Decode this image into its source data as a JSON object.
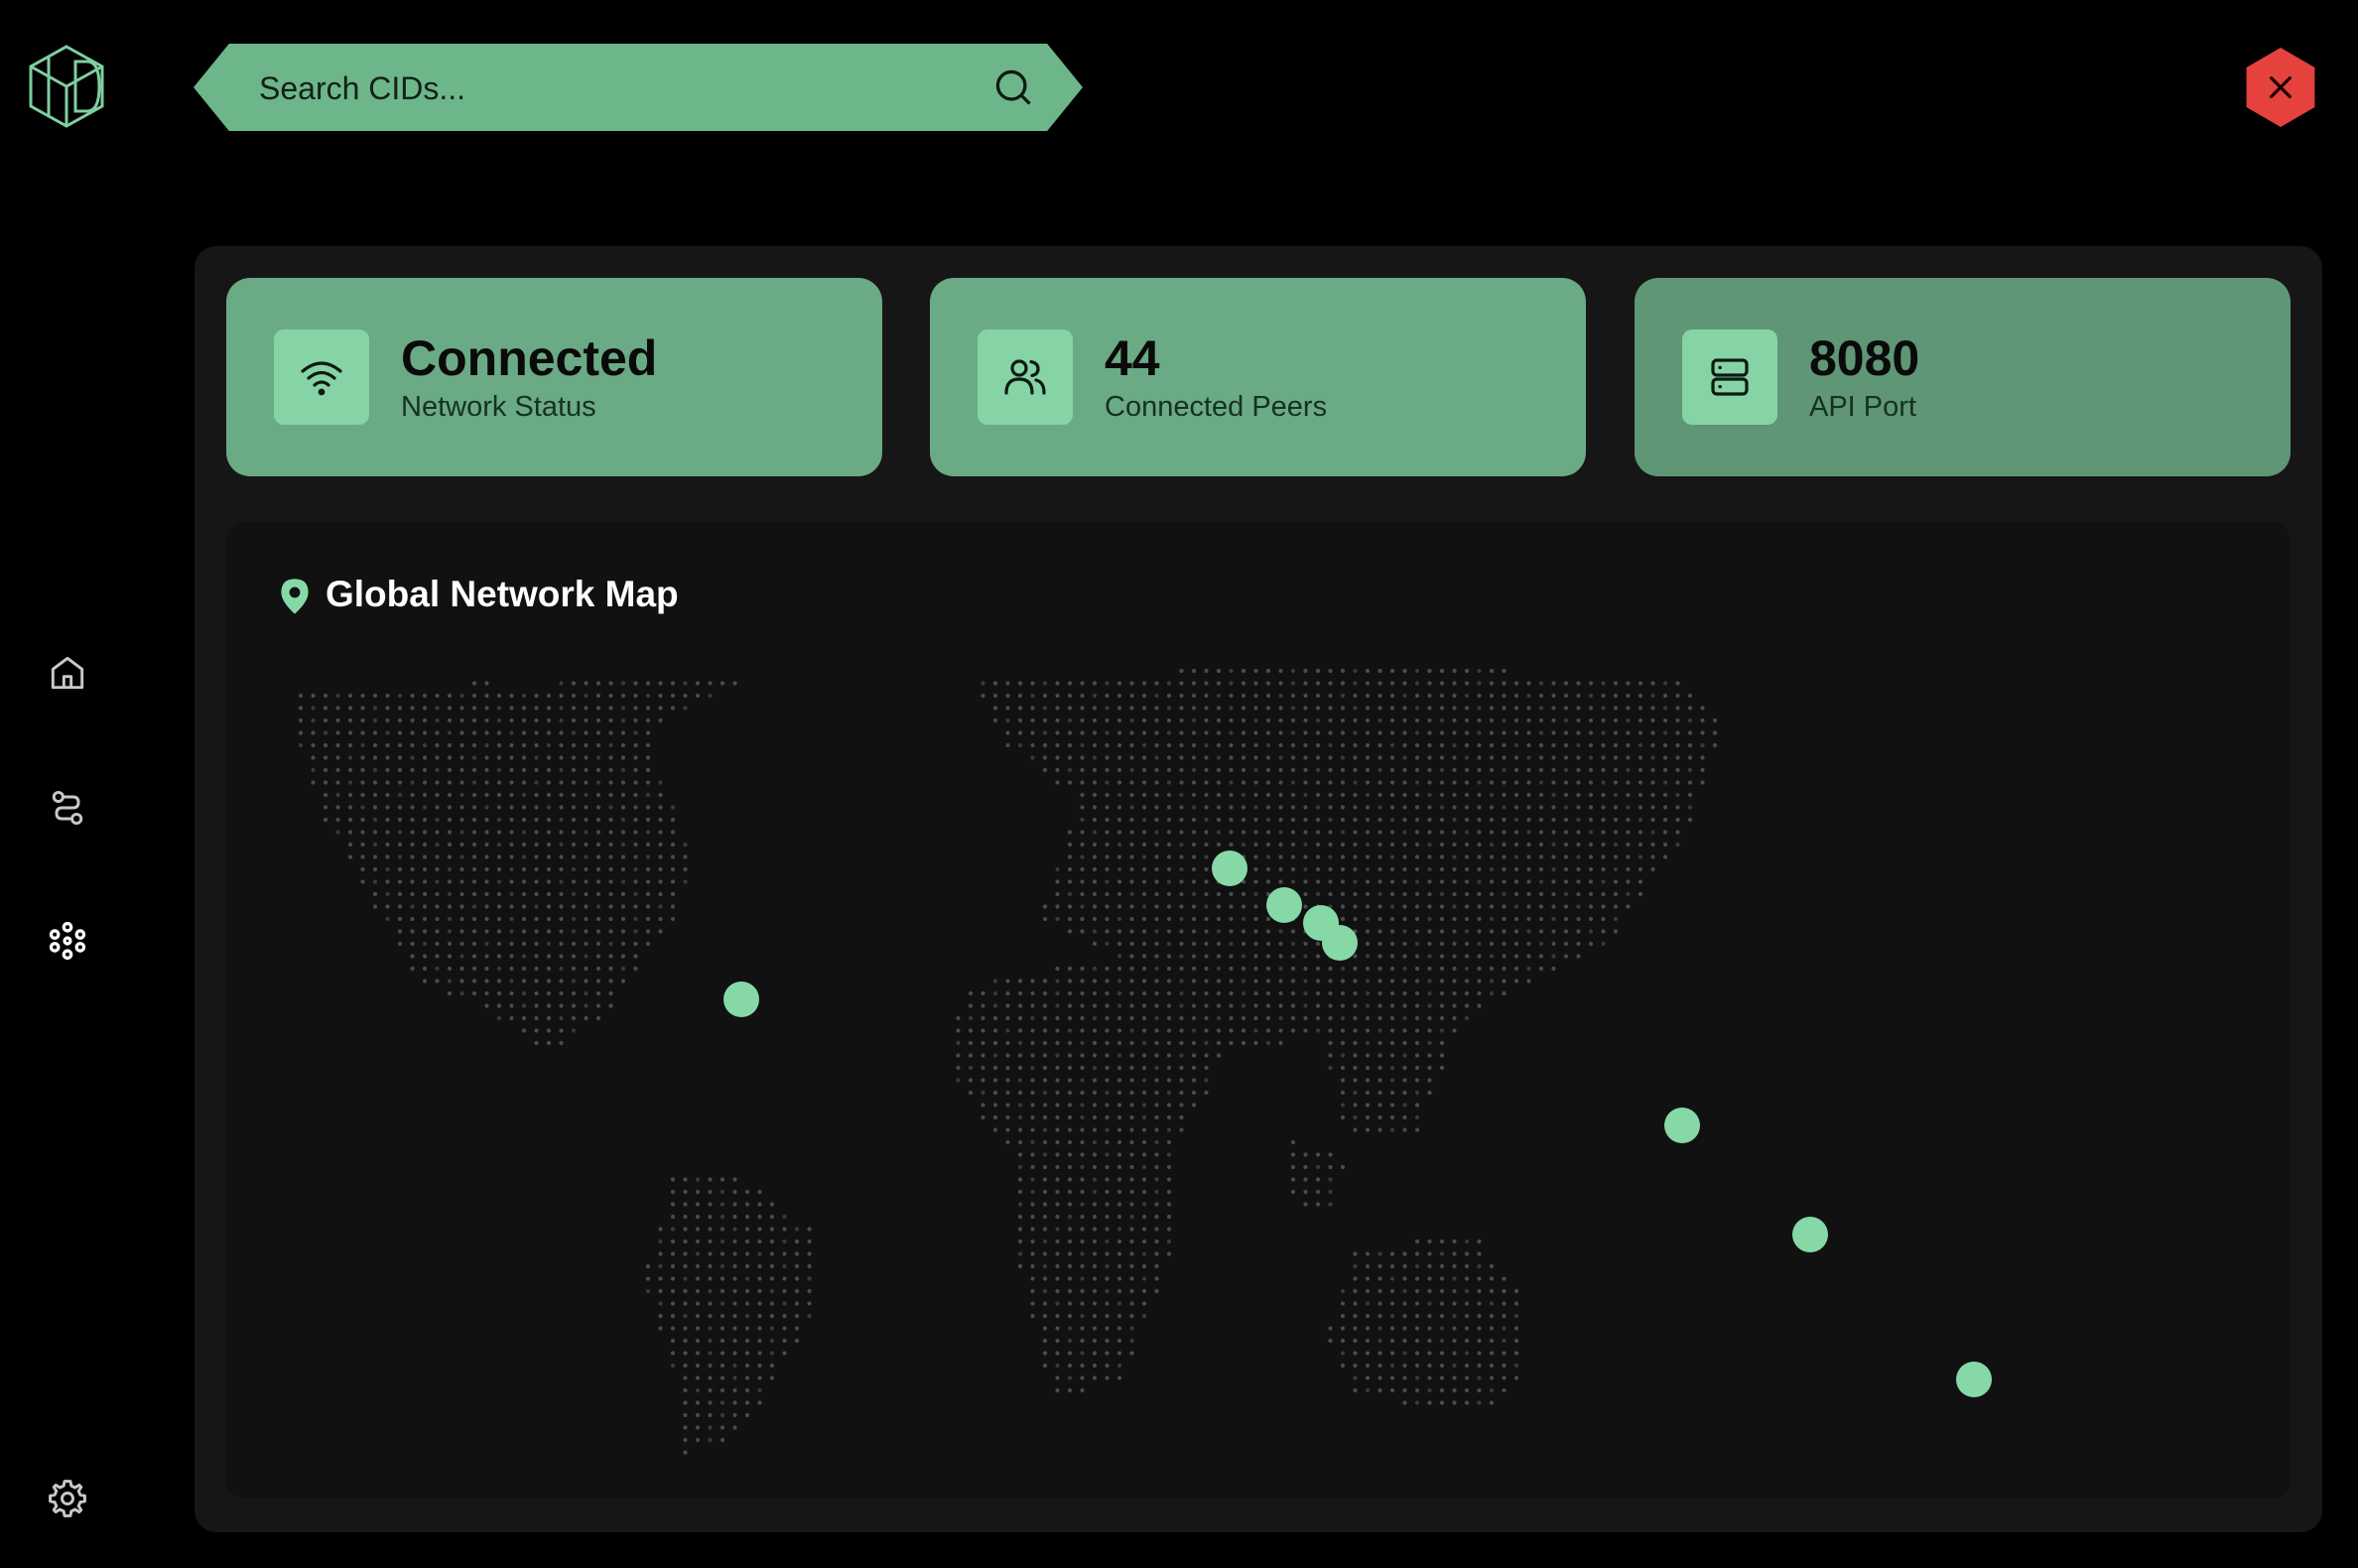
{
  "app": {
    "logo_icon": "hexagon-cube-logo-icon",
    "accent": "#6db68a",
    "close_color": "#e5413d"
  },
  "search": {
    "placeholder": "Search CIDs...",
    "icon": "search-icon"
  },
  "sidebar": {
    "items": [
      {
        "name": "home",
        "icon": "home-icon"
      },
      {
        "name": "routes",
        "icon": "route-icon"
      },
      {
        "name": "peers",
        "icon": "nodes-icon",
        "active": true
      },
      {
        "name": "settings",
        "icon": "gear-icon"
      }
    ]
  },
  "stats": [
    {
      "value": "Connected",
      "label": "Network Status",
      "icon": "wifi-icon",
      "color": "#6aaa84"
    },
    {
      "value": "44",
      "label": "Connected Peers",
      "icon": "users-icon",
      "color": "#6aaa84"
    },
    {
      "value": "8080",
      "label": "API Port",
      "icon": "server-icon",
      "color": "#5e9676"
    }
  ],
  "map": {
    "title": "Global Network Map",
    "icon": "map-pin-icon",
    "peer_color": "#86d9a6"
  }
}
